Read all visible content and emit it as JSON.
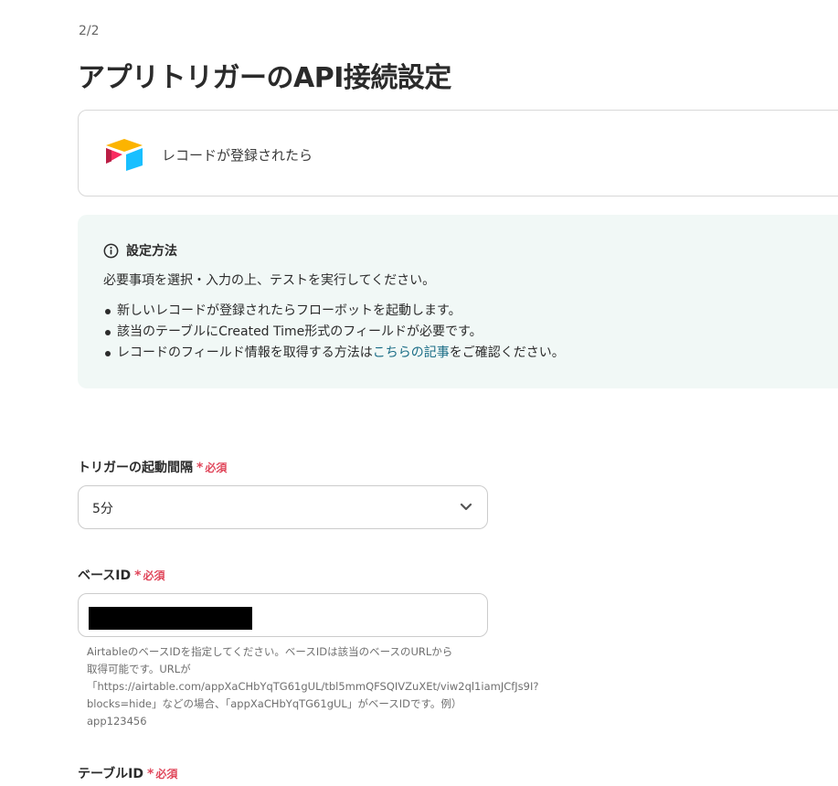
{
  "step": "2/2",
  "title": "アプリトリガーのAPI接続設定",
  "app": {
    "logo_icon": "airtable-logo",
    "trigger_name": "レコードが登録されたら"
  },
  "info": {
    "icon": "info-icon",
    "title": "設定方法",
    "description": "必要事項を選択・入力の上、テストを実行してください。",
    "bullets": [
      "新しいレコードが登録されたらフローボットを起動します。",
      "該当のテーブルにCreated Time形式のフィールドが必要です。"
    ],
    "bullet3_before": "レコードのフィールド情報を取得する方法は",
    "bullet3_link": "こちらの記事",
    "bullet3_after": "をご確認ください。",
    "link_color": "#1a6d86"
  },
  "required_star": "*",
  "required_text": "必須",
  "required_color": "#e0475b",
  "fields": {
    "interval": {
      "label": "トリガーの起動間隔",
      "value": "5分"
    },
    "base_id": {
      "label": "ベースID",
      "value_redacted": true,
      "help_lines": [
        "AirtableのベースIDを指定してください。ベースIDは該当のベースのURLから",
        "取得可能です。URLが",
        "「https://airtable.com/appXaCHbYqTG61gUL/tbl5mmQFSQIVZuXEt/viw2ql1iamJCfJs9I?",
        "blocks=hide」などの場合、「appXaCHbYqTG61gUL」がベースIDです。例）",
        "app123456"
      ]
    },
    "table_id": {
      "label": "テーブルID"
    }
  }
}
